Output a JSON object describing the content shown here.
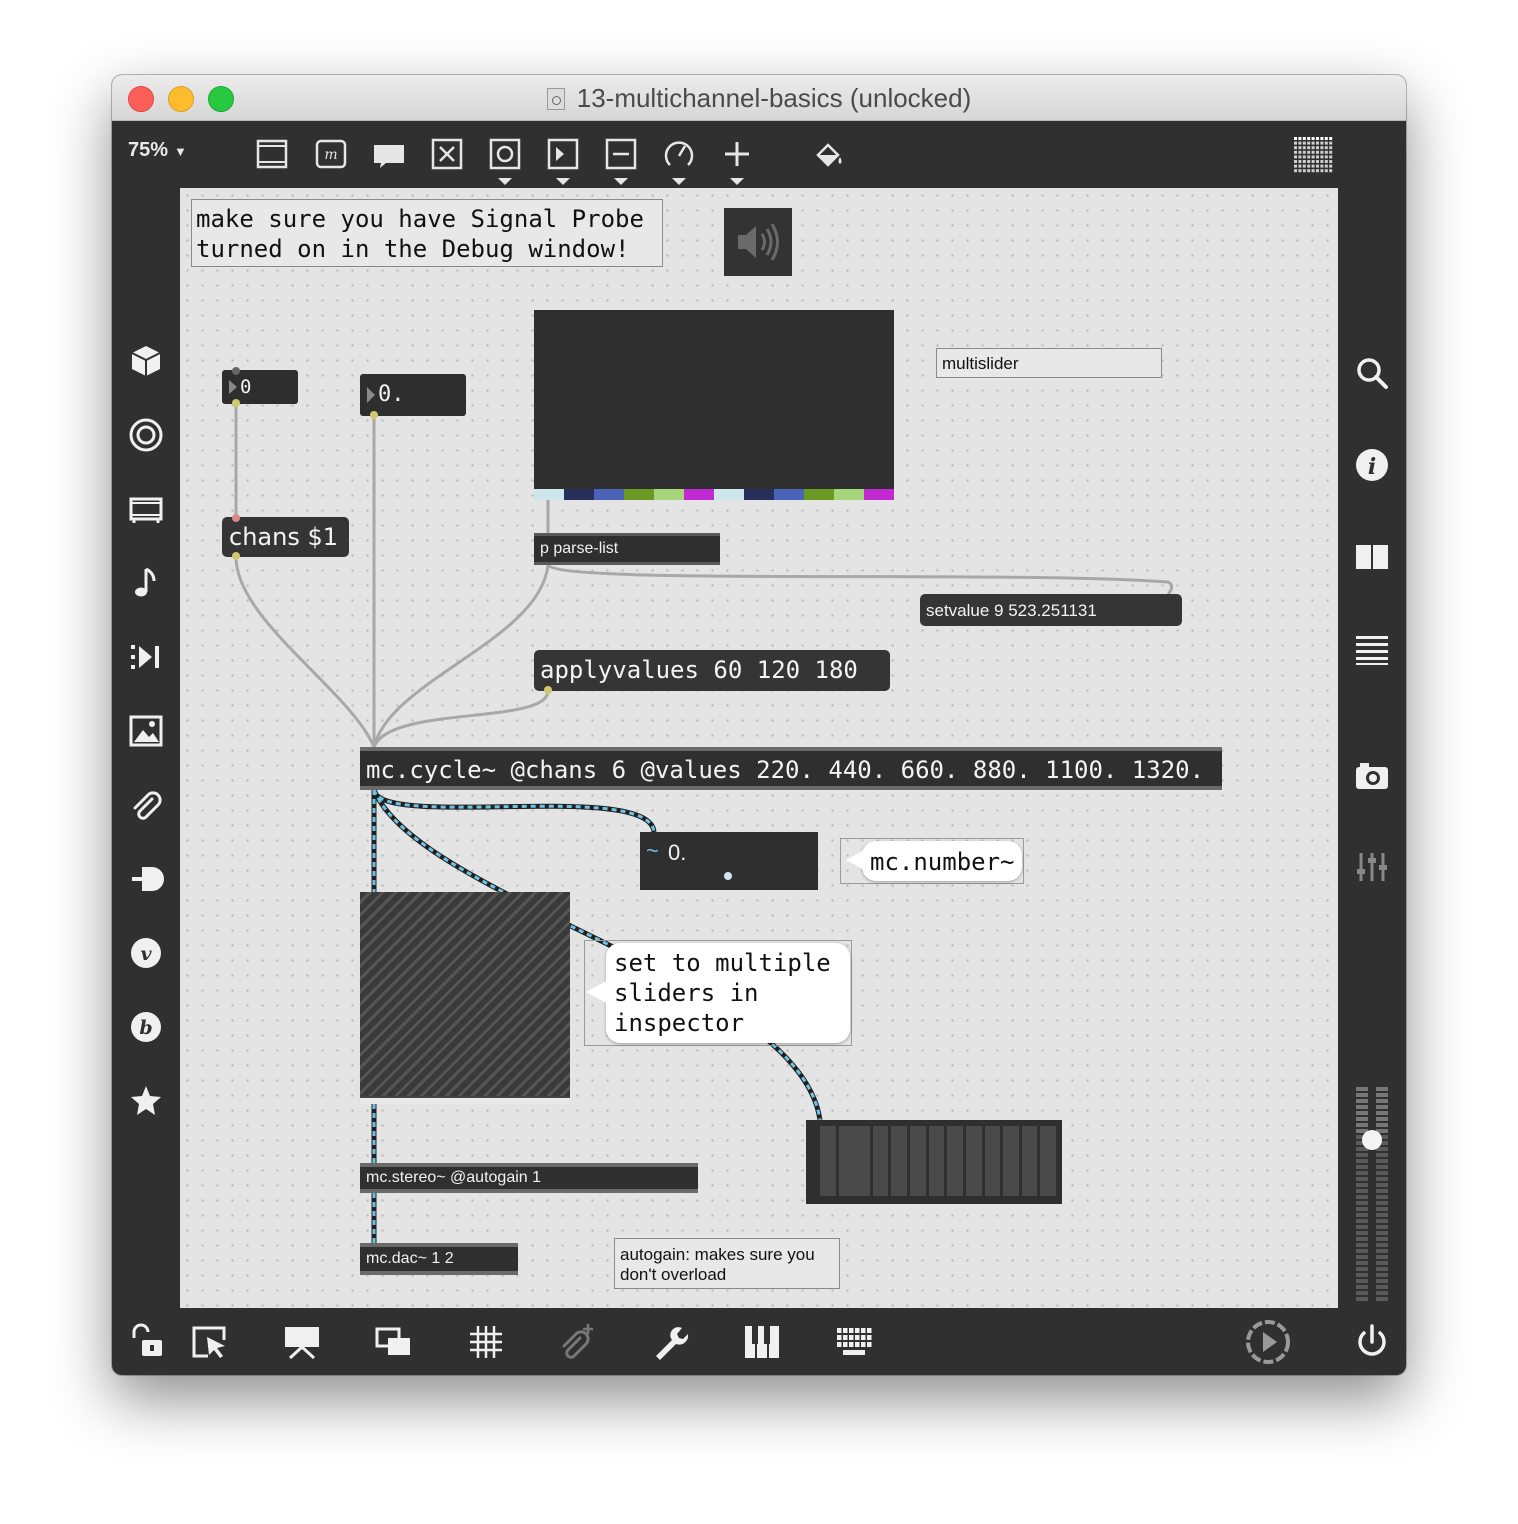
{
  "window": {
    "title": "13-multichannel-basics (unlocked)"
  },
  "toolbar": {
    "zoom": "75%",
    "icons": [
      "object-box-icon",
      "message-icon",
      "comment-icon",
      "toggle-icon",
      "button-icon",
      "number-icon",
      "slider-icon",
      "dial-icon",
      "add-object-icon",
      "paint-bucket-icon",
      "grid-menu-icon"
    ]
  },
  "patch": {
    "comment_signal_probe": "make sure you have Signal Probe\nturned on in the Debug window!",
    "number_int": "0",
    "number_float": "0.",
    "chans_msg": "chans $1",
    "multislider_label": "multislider",
    "parse_list": "p parse-list",
    "setvalue_msg": "setvalue 9 523.251131",
    "applyvalues_msg": "applyvalues 60 120 180",
    "mc_cycle": "mc.cycle~ @chans 6 @values 220. 440. 660. 880. 1100. 1320.",
    "mc_number_value": "0.",
    "mc_number_label": "mc.number~",
    "sliders_hint": "set to multiple\nsliders in\ninspector",
    "mc_stereo": "mc.stereo~ @autogain 1",
    "mc_dac": "mc.dac~ 1 2",
    "autogain_note": "autogain: makes sure you\ndon't overload",
    "multislider_colors": [
      "#cde7ec",
      "#26305a",
      "#4a63b8",
      "#6b9a24",
      "#a6d67c",
      "#c02ad0",
      "#cde7ec",
      "#26305a",
      "#4a63b8",
      "#6b9a24",
      "#a6d67c",
      "#c02ad0"
    ],
    "patchcord_signal_color": "#6bc3e8"
  },
  "left_sidebar": {
    "icons": [
      "cube-icon",
      "target-icon",
      "film-icon",
      "music-note-icon",
      "step-forward-icon",
      "image-icon",
      "paperclip-icon",
      "plug-icon",
      "vimeo-v-icon",
      "bold-b-icon",
      "star-icon"
    ]
  },
  "right_sidebar": {
    "icons": [
      "search-icon",
      "info-icon",
      "columns-icon",
      "list-icon",
      "camera-icon",
      "mixer-icon",
      "level-meter-icon"
    ]
  },
  "bottom_bar": {
    "icons": [
      "lock-icon",
      "select-cursor-icon",
      "presentation-icon",
      "window-stack-icon",
      "grid-icon",
      "attach-icon",
      "wrench-icon",
      "piano-icon",
      "keyboard-icon",
      "play-audio-icon",
      "power-icon"
    ]
  }
}
